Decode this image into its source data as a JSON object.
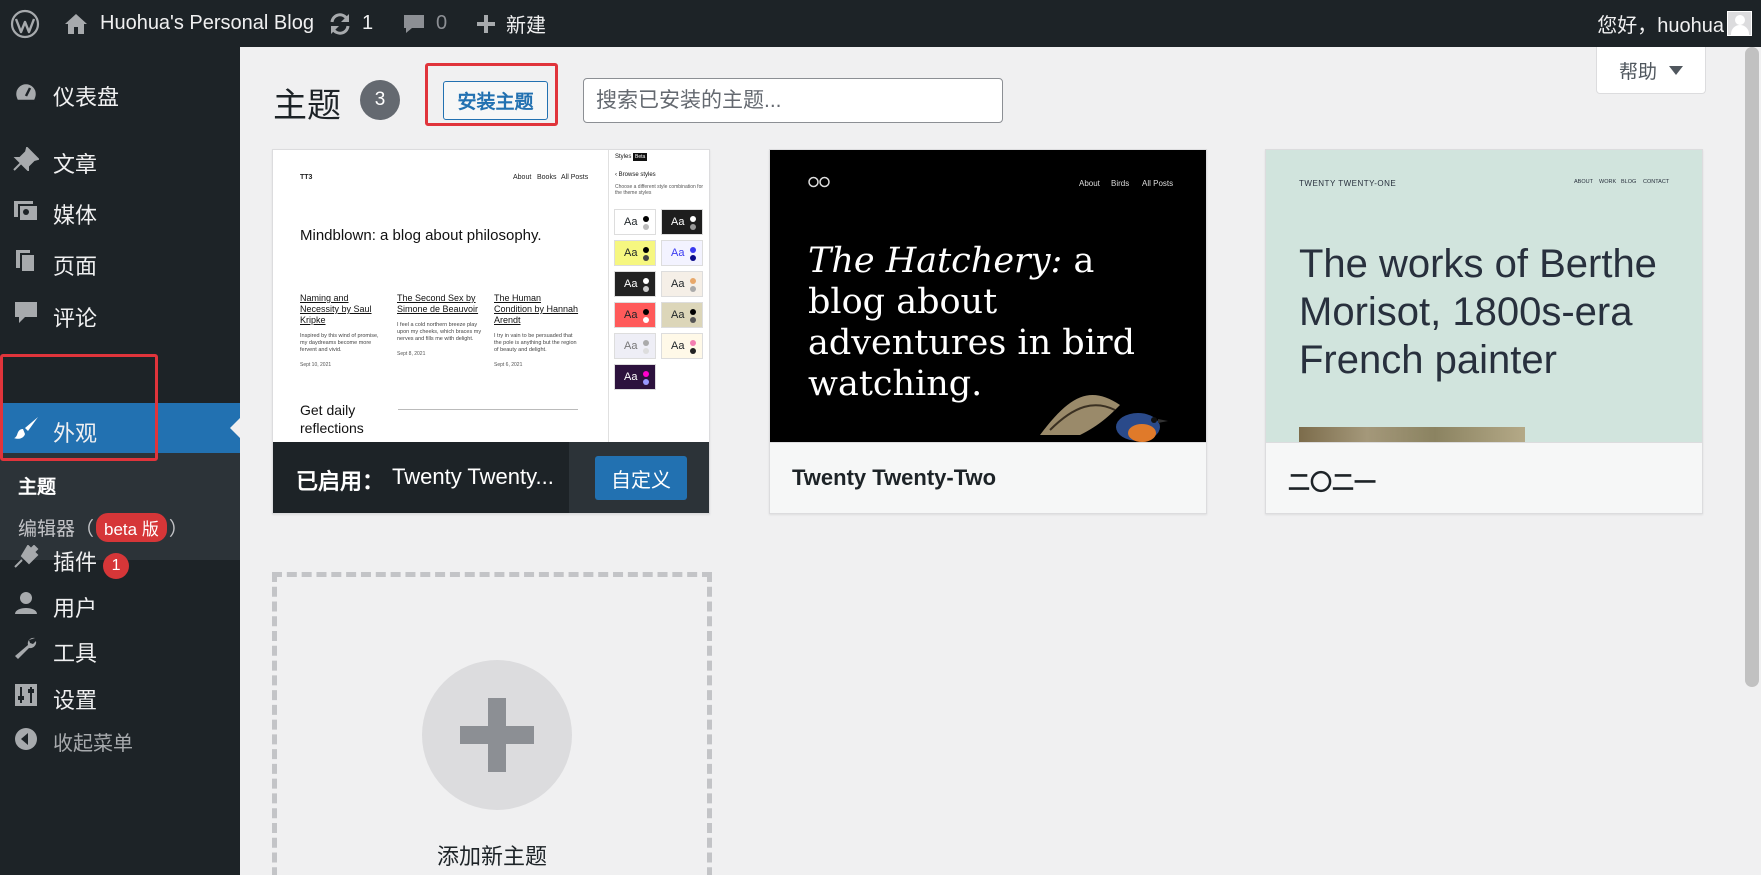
{
  "admin_bar": {
    "site_name": "Huohua's Personal Blog",
    "updates_count": "1",
    "comments_count": "0",
    "new_label": "新建",
    "greeting": "您好，huohua"
  },
  "sidebar": {
    "items": [
      {
        "label": "仪表盘",
        "icon": "dashboard-icon"
      },
      {
        "label": "文章",
        "icon": "pin-icon"
      },
      {
        "label": "媒体",
        "icon": "media-icon"
      },
      {
        "label": "页面",
        "icon": "pages-icon"
      },
      {
        "label": "评论",
        "icon": "comment-icon"
      },
      {
        "label": "外观",
        "icon": "appearance-brush-icon"
      },
      {
        "label": "插件",
        "icon": "plugins-icon",
        "badge": "1"
      },
      {
        "label": "用户",
        "icon": "users-icon"
      },
      {
        "label": "工具",
        "icon": "tools-icon"
      },
      {
        "label": "设置",
        "icon": "settings-icon"
      },
      {
        "label": "收起菜单",
        "icon": "collapse-icon"
      }
    ],
    "submenu": {
      "themes_label": "主题",
      "editor_prefix": "编辑器（",
      "editor_beta": "beta 版",
      "editor_suffix": "）"
    }
  },
  "main": {
    "title": "主题",
    "theme_count": "3",
    "install_button": "安装主题",
    "search_placeholder": "搜索已安装的主题...",
    "help_button": "帮助"
  },
  "themes": [
    {
      "active_label": "已启用：",
      "name": "Twenty Twenty...",
      "customize_label": "自定义",
      "preview": {
        "site": "TT3",
        "nav": [
          "About",
          "Books",
          "All Posts"
        ],
        "headline": "Mindblown: a blog about philosophy.",
        "posts": [
          {
            "title": "Naming and Necessity by Saul Kripke",
            "excerpt": "Inspired by this wind of promise, my daydreams become more fervent and vivid.",
            "date": "Sept 10, 2021"
          },
          {
            "title": "The Second Sex by Simone de Beauvoir",
            "excerpt": "I feel a cold northern breeze play upon my cheeks, which braces my nerves and fills me with delight.",
            "date": "Sept 8, 2021"
          },
          {
            "title": "The Human Condition by Hannah Arendt",
            "excerpt": "I try in vain to be persuaded that the pole is anything but the region of beauty and delight.",
            "date": "Sept 6, 2021"
          }
        ],
        "footer_text": "Get daily reflections",
        "panel_title": "Styles",
        "panel_beta": "Beta",
        "panel_subtitle": "Browse styles",
        "panel_desc": "Choose a different style combination for the theme styles",
        "swatch_text": "Aa"
      }
    },
    {
      "name": "Twenty Twenty-Two",
      "preview": {
        "nav": [
          "About",
          "Birds",
          "All Posts"
        ],
        "headline_italic": "The Hatchery:",
        "headline_rest": " a blog about adventures in bird watching."
      }
    },
    {
      "name": "二〇二一",
      "preview": {
        "site": "TWENTY TWENTY-ONE",
        "nav": [
          "ABOUT",
          "WORK",
          "BLOG",
          "CONTACT"
        ],
        "headline": "The works of Berthe Morisot, 1800s-era French painter"
      }
    }
  ],
  "add_theme": {
    "label": "添加新主题"
  },
  "colors": {
    "admin_dark": "#1d2327",
    "accent_blue": "#2271b1",
    "badge_red": "#d63638",
    "highlight_red": "#e0343b"
  }
}
